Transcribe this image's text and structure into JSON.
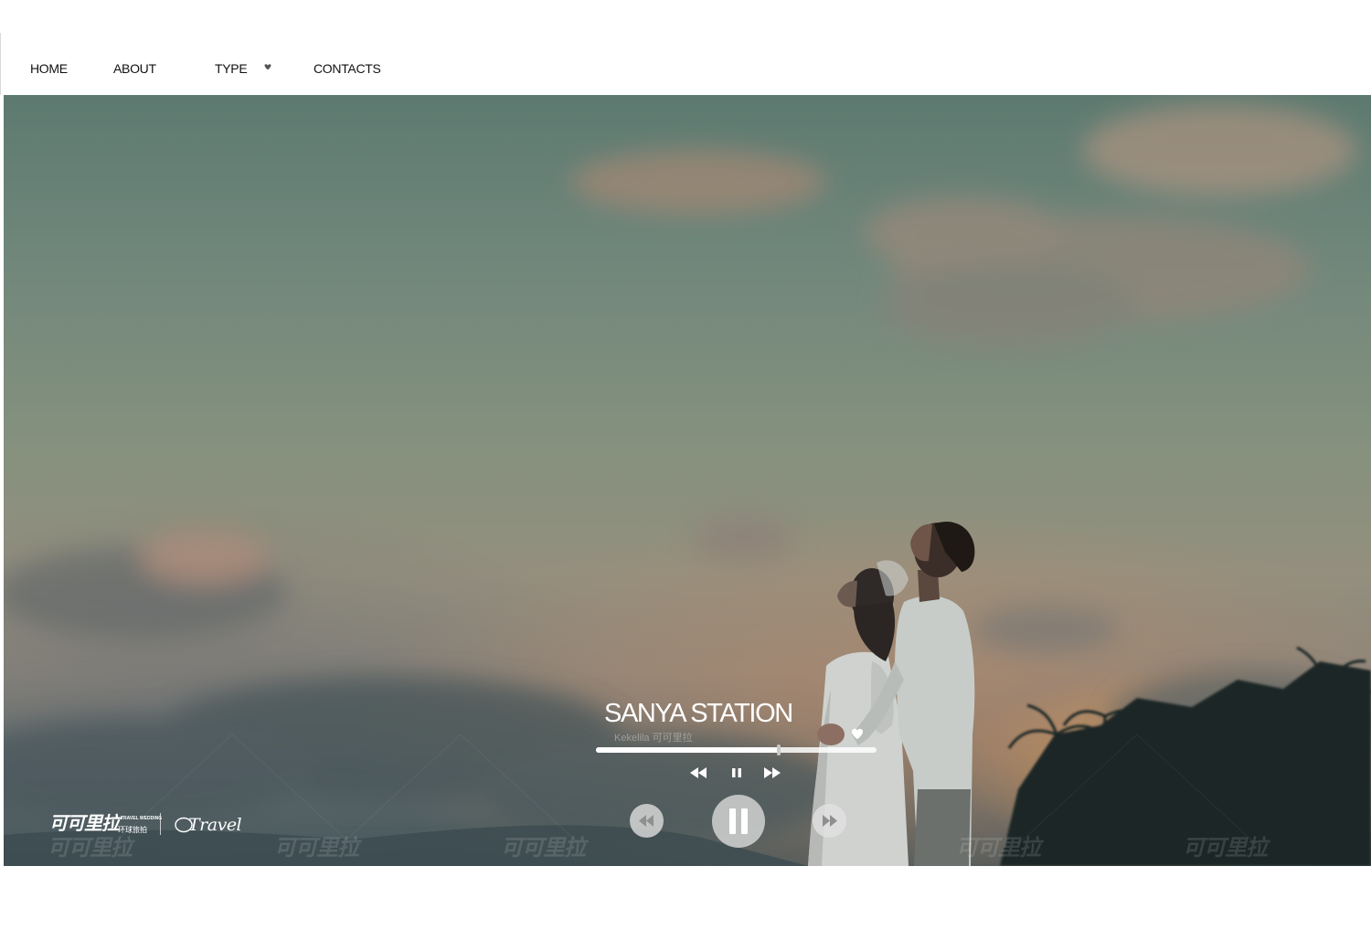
{
  "nav": {
    "items": [
      {
        "label": "HOME"
      },
      {
        "label": "ABOUT"
      },
      {
        "label": "TYPE"
      },
      {
        "label": "CONTACTS"
      }
    ]
  },
  "player": {
    "title": "SANYA STATION",
    "artist": "Kekelila 可可里拉",
    "progress": 0.65
  },
  "brand": {
    "logo_cn": "可可里拉",
    "logo_en_top": "TRAVEL WEDDING",
    "logo_en_bottom": "环球旅拍",
    "logo_travel": "Travel",
    "watermark": "可可里拉"
  },
  "colors": {
    "nav_bg": "#ffffff",
    "nav_text": "#111111",
    "player_text": "#ffffff"
  },
  "icons": [
    "caret-down-icon",
    "heart-icon",
    "rewind-icon",
    "pause-icon",
    "fast-forward-icon"
  ]
}
